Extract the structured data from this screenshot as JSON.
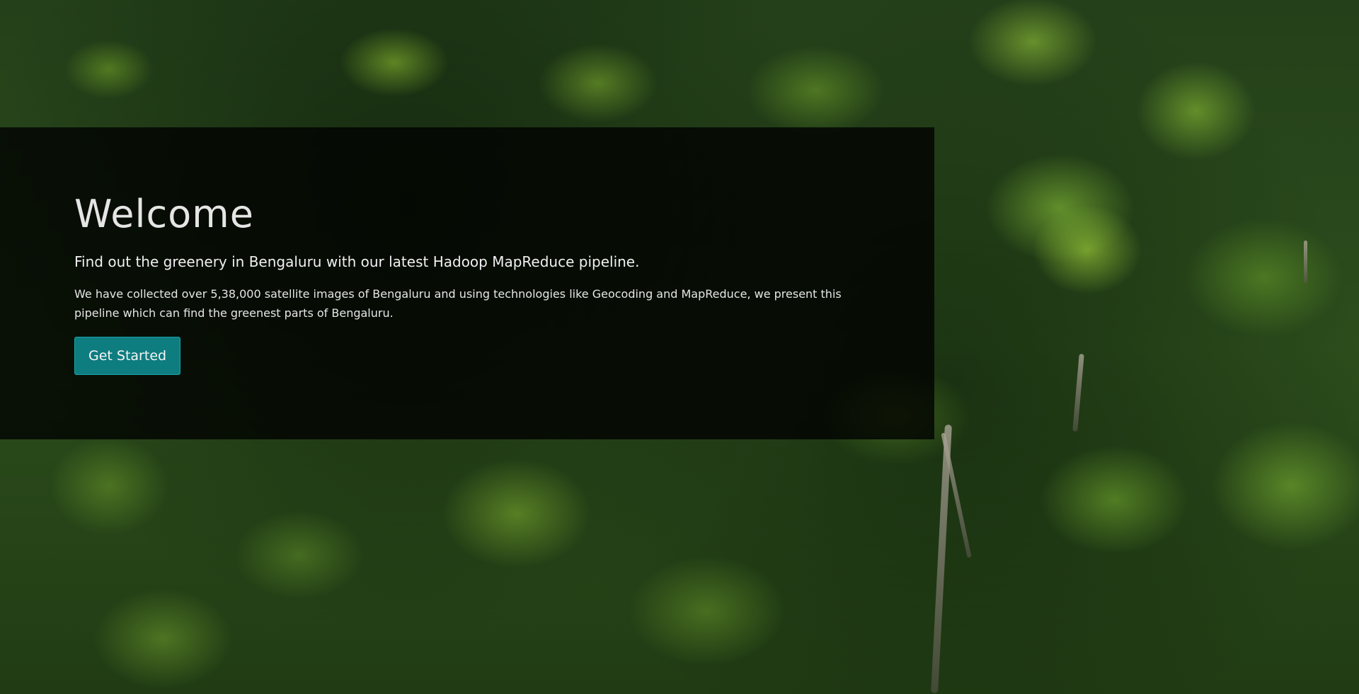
{
  "hero": {
    "title": "Welcome",
    "lead": "Find out the greenery in Bengaluru with our latest Hadoop MapReduce pipeline.",
    "description": "We have collected over 5,38,000 satellite images of Bengaluru and using technologies like Geocoding and MapReduce, we present this pipeline which can find the greenest parts of Bengaluru.",
    "button_label": "Get Started"
  },
  "theme": {
    "panel_color": "#000000",
    "button_color": "#0e7d80",
    "background": "forest canopy photo"
  }
}
